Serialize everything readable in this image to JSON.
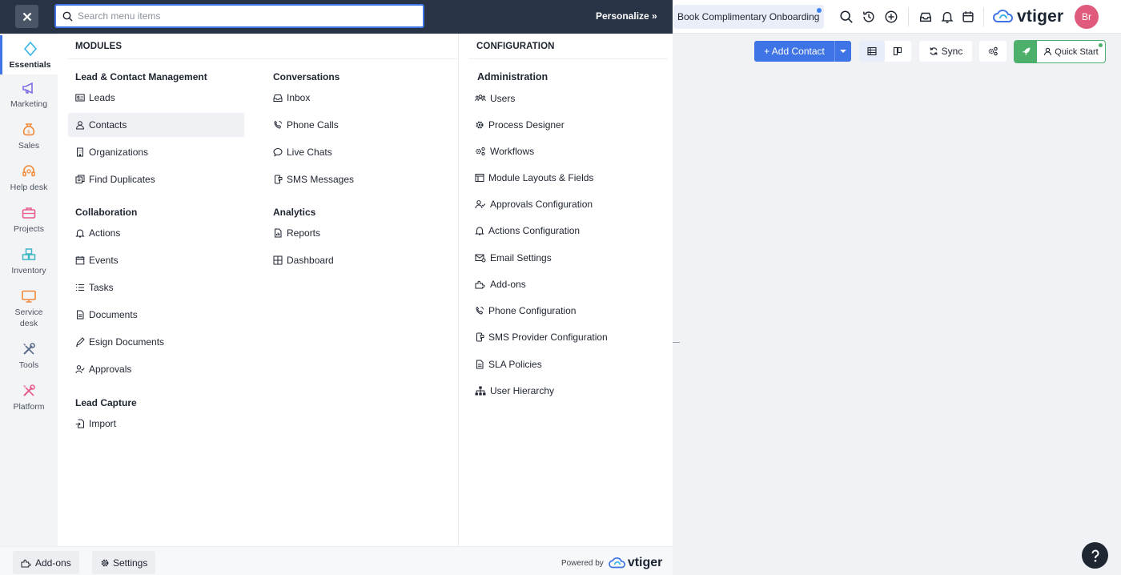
{
  "menu": {
    "search_placeholder": "Search menu items",
    "personalize_label": "Personalize",
    "close_icon": "close-icon",
    "personalize_icon": "double-chevron-right-icon"
  },
  "rail": [
    {
      "label": "Essentials",
      "icon": "diamond-icon",
      "active": true,
      "color": "#38b4e8"
    },
    {
      "label": "Marketing",
      "icon": "megaphone-icon",
      "color": "#7c6ee6"
    },
    {
      "label": "Sales",
      "icon": "money-bag-icon",
      "color": "#f08a3c"
    },
    {
      "label": "Help desk",
      "icon": "headset-icon",
      "color": "#f08a3c"
    },
    {
      "label": "Projects",
      "icon": "briefcase-icon",
      "color": "#e85b8d"
    },
    {
      "label": "Inventory",
      "icon": "boxes-icon",
      "color": "#3cb5c4"
    },
    {
      "label": "Service desk",
      "icon": "monitor-icon",
      "color": "#f08a3c"
    },
    {
      "label": "Tools",
      "icon": "tools-icon",
      "color": "#5b6b8a"
    },
    {
      "label": "Platform",
      "icon": "wrench-icon",
      "color": "#e85b8d"
    }
  ],
  "modules": {
    "heading": "MODULES",
    "lead_contact": {
      "title": "Lead & Contact Management",
      "items": [
        "Leads",
        "Contacts",
        "Organizations",
        "Find Duplicates"
      ]
    },
    "collaboration": {
      "title": "Collaboration",
      "items": [
        "Actions",
        "Events",
        "Tasks",
        "Documents",
        "Esign Documents",
        "Approvals"
      ]
    },
    "lead_capture": {
      "title": "Lead Capture",
      "items": [
        "Import"
      ]
    },
    "conversations": {
      "title": "Conversations",
      "items": [
        "Inbox",
        "Phone Calls",
        "Live Chats",
        "SMS Messages"
      ]
    },
    "analytics": {
      "title": "Analytics",
      "items": [
        "Reports",
        "Dashboard"
      ]
    }
  },
  "configuration": {
    "heading": "CONFIGURATION",
    "administration": {
      "title": "Administration",
      "items": [
        "Users",
        "Process Designer",
        "Workflows",
        "Module Layouts & Fields",
        "Approvals Configuration",
        "Actions Configuration",
        "Email Settings",
        "Add-ons",
        "Phone Configuration",
        "SMS Provider Configuration",
        "SLA Policies",
        "User Hierarchy"
      ]
    }
  },
  "bottom": {
    "addons_label": "Add-ons",
    "settings_label": "Settings",
    "powered_by": "Powered by",
    "brand": "vtiger"
  },
  "header": {
    "onboarding_label": "Book Complimentary Onboarding",
    "brand": "vtiger",
    "avatar_initials": "Br"
  },
  "toolbar": {
    "add_contact_label": "+ Add Contact",
    "sync_label": "Sync",
    "quick_start_label": "Quick Start"
  },
  "colors": {
    "accent": "#3f74e6",
    "menu_topbar": "#283445",
    "quick_start_green": "#4caf6a",
    "avatar": "#e05a7b"
  }
}
